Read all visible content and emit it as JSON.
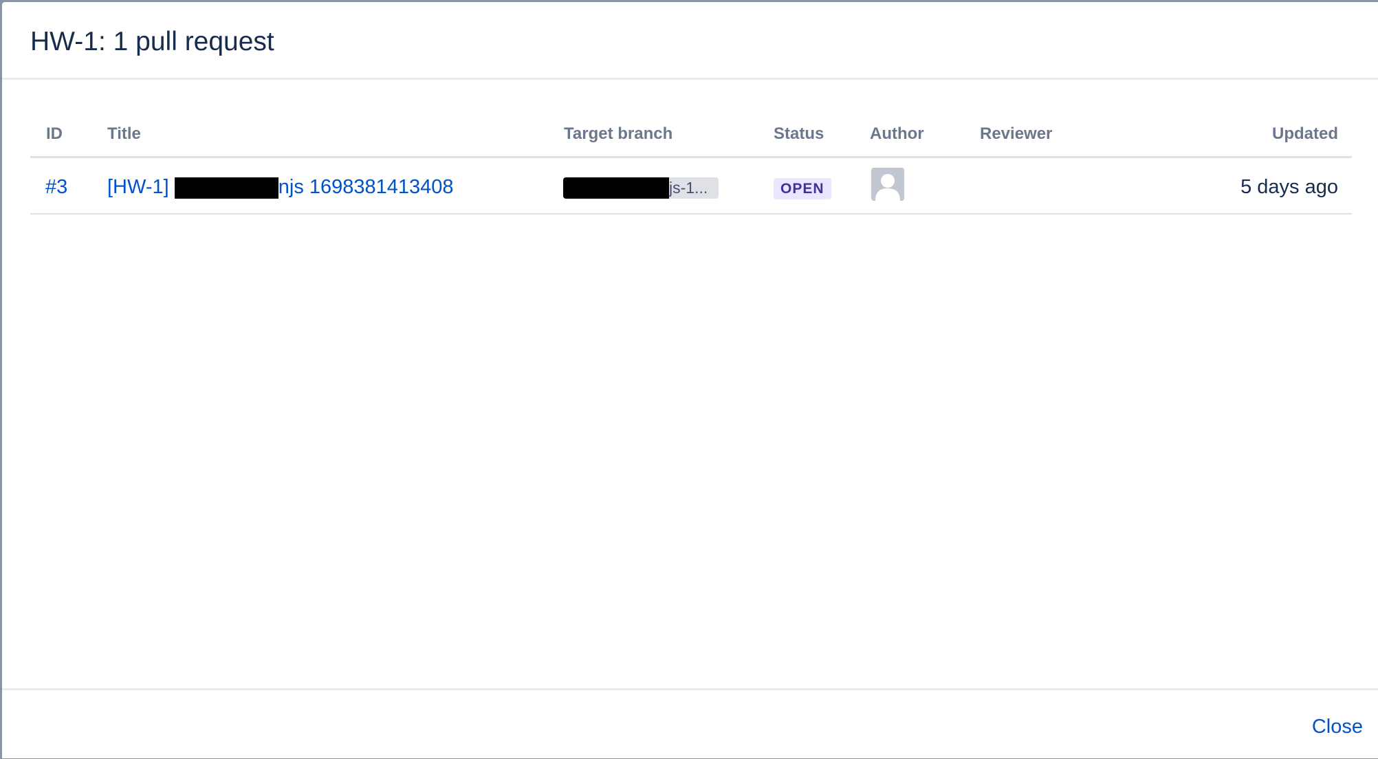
{
  "dialog": {
    "title": "HW-1: 1 pull request"
  },
  "table": {
    "headers": {
      "id": "ID",
      "title": "Title",
      "target_branch": "Target branch",
      "status": "Status",
      "author": "Author",
      "reviewer": "Reviewer",
      "updated": "Updated"
    },
    "rows": [
      {
        "id": "#3",
        "title_prefix": "[HW-1] ",
        "title_suffix": "njs 1698381413408",
        "target_branch_suffix": "js-1...",
        "status": "OPEN",
        "author_icon": "default-avatar-icon",
        "reviewer": "",
        "updated": "5 days ago"
      }
    ]
  },
  "footer": {
    "close_label": "Close"
  },
  "colors": {
    "link": "#0052cc",
    "heading": "#172b4d",
    "header_text": "#6b778c",
    "status_bg": "#eae6ff",
    "status_text": "#403294"
  }
}
